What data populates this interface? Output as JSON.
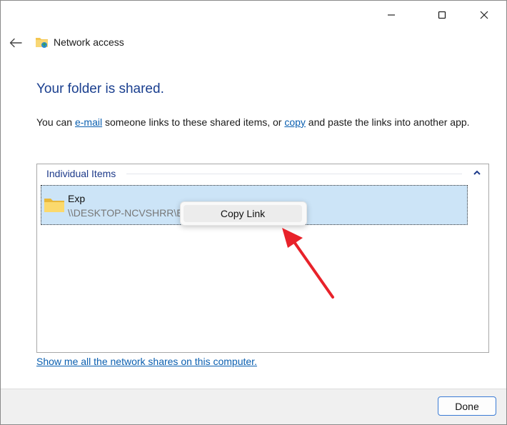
{
  "window": {
    "title": "Network access",
    "controls": {
      "minimize_icon": "minimize-icon",
      "maximize_icon": "maximize-icon",
      "close_icon": "close-icon"
    }
  },
  "main": {
    "heading": "Your folder is shared.",
    "description": {
      "part1": "You can ",
      "email_link": "e-mail",
      "part2": " someone links to these shared items, or ",
      "copy_link": "copy",
      "part3": " and paste the links into another app."
    },
    "items_group": {
      "header": "Individual Items",
      "items": [
        {
          "name": "Exp",
          "path": "\\\\DESKTOP-NCVSHRR\\Exp",
          "icon": "folder-icon"
        }
      ]
    },
    "context_menu": {
      "items": [
        {
          "label": "Copy Link"
        }
      ]
    },
    "annotation": {
      "type": "arrow",
      "color": "#e8222a"
    },
    "bottom_link": "Show me all the network shares on this computer."
  },
  "footer": {
    "done_label": "Done"
  },
  "colors": {
    "accent": "#1a3f8f",
    "link": "#0a5fb0",
    "selection": "#cce4f7",
    "arrow": "#e8222a"
  }
}
